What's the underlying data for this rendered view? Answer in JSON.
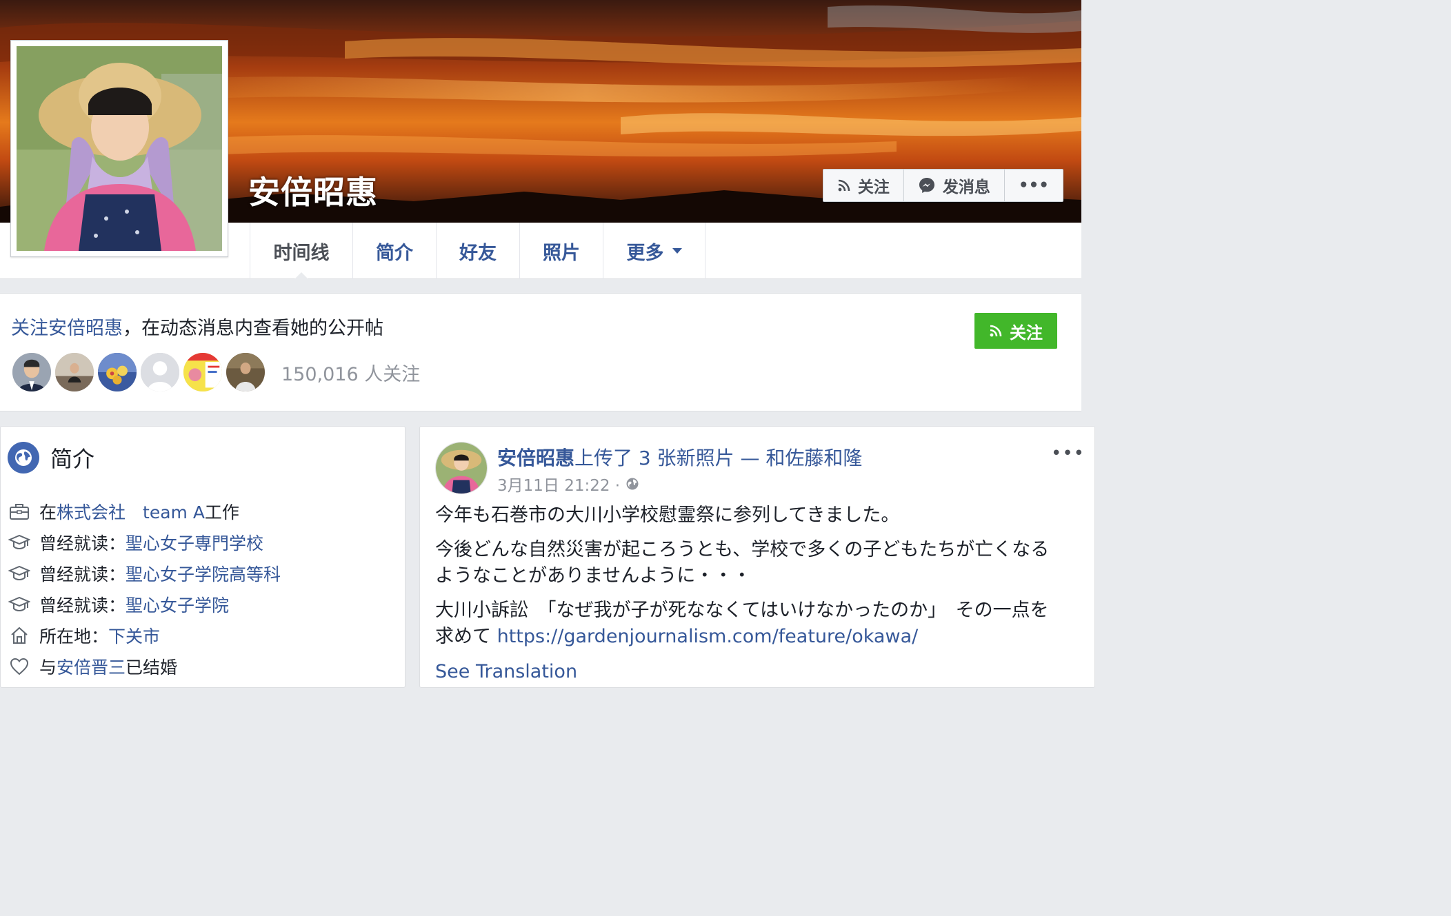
{
  "profile": {
    "name": "安倍昭惠"
  },
  "cover_actions": {
    "follow": "关注",
    "message": "发消息",
    "more": "•••"
  },
  "nav": {
    "tabs": [
      {
        "label": "时间线",
        "active": true
      },
      {
        "label": "简介"
      },
      {
        "label": "好友"
      },
      {
        "label": "照片"
      },
      {
        "label": "更多"
      }
    ]
  },
  "follow_box": {
    "link_text": "关注安倍昭惠",
    "rest_text": "，在动态消息内查看她的公开帖",
    "button": "关注",
    "follower_count": "150,016 人关注"
  },
  "intro": {
    "title": "简介",
    "items": [
      {
        "icon": "briefcase-icon",
        "prefix": "在",
        "link": "株式会社　team A",
        "suffix": "工作"
      },
      {
        "icon": "graduation-cap-icon",
        "prefix": "曾经就读：",
        "link": "聖心女子専門学校",
        "suffix": ""
      },
      {
        "icon": "graduation-cap-icon",
        "prefix": "曾经就读：",
        "link": "聖心女子学院高等科",
        "suffix": ""
      },
      {
        "icon": "graduation-cap-icon",
        "prefix": "曾经就读：",
        "link": "聖心女子学院",
        "suffix": ""
      },
      {
        "icon": "home-icon",
        "prefix": "所在地：",
        "link": "下关市",
        "suffix": ""
      },
      {
        "icon": "heart-icon",
        "prefix": "与",
        "link": "安倍晋三",
        "suffix": "已结婚"
      }
    ]
  },
  "post": {
    "author": "安倍昭惠",
    "action": "上传了 3 张新照片 — 和佐藤和隆",
    "timestamp": "3月11日 21:22 ·",
    "more": "•••",
    "paragraphs": [
      "今年も石巻市の大川小学校慰霊祭に参列してきました。",
      "今後どんな自然災害が起ころうとも、学校で多くの子どもたちが亡くなるようなことがありませんように・・・",
      "大川小訴訟　「なぜ我が子が死ななくてはいけなかったのか」　その一点を求めて "
    ],
    "url": "https://gardenjournalism.com/feature/okawa/",
    "see_translation": "See Translation"
  },
  "colors": {
    "link": "#365899",
    "follow_green": "#42b72a",
    "page_bg": "#e9ebee"
  }
}
